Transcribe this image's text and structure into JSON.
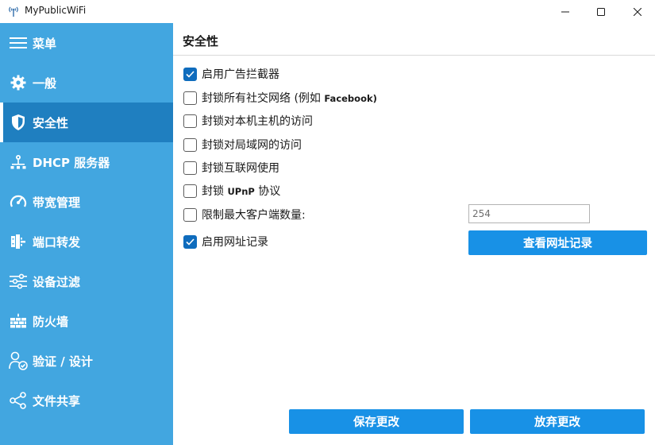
{
  "window": {
    "title": "MyPublicWiFi",
    "app_icon": "wifi-antenna-icon",
    "controls": {
      "minimize": "minimize-icon",
      "maximize": "maximize-icon",
      "close": "close-icon"
    }
  },
  "sidebar": {
    "background": "#42a6e0",
    "active_background": "#1f7fc0",
    "items": [
      {
        "label": "菜单",
        "icon": "hamburger-menu-icon",
        "active": false
      },
      {
        "label": "一般",
        "icon": "gear-icon",
        "active": false
      },
      {
        "label": "安全性",
        "icon": "shield-icon",
        "active": true
      },
      {
        "label": "DHCP 服务器",
        "icon": "network-icon",
        "active": false
      },
      {
        "label": "带宽管理",
        "icon": "speedometer-icon",
        "active": false
      },
      {
        "label": "端口转发",
        "icon": "port-forward-icon",
        "active": false
      },
      {
        "label": "设备过滤",
        "icon": "sliders-icon",
        "active": false
      },
      {
        "label": "防火墙",
        "icon": "firewall-icon",
        "active": false
      },
      {
        "label": "验证 / 设计",
        "icon": "user-check-icon",
        "active": false
      },
      {
        "label": "文件共享",
        "icon": "share-icon",
        "active": false
      }
    ]
  },
  "main": {
    "title": "安全性",
    "options": [
      {
        "label": "启用广告拦截器",
        "checked": true
      },
      {
        "label": "封锁所有社交网络 (例如 ",
        "label_suffix": "Facebook)",
        "checked": false
      },
      {
        "label": "封锁对本机主机的访问",
        "checked": false
      },
      {
        "label": "封锁对局域网的访问",
        "checked": false
      },
      {
        "label": "封锁互联网使用",
        "checked": false
      },
      {
        "label": "封锁 ",
        "label_mid": "UPnP",
        "label_suffix": " 协议",
        "checked": false
      },
      {
        "label": "限制最大客户端数量:",
        "checked": false
      },
      {
        "label": "启用网址记录",
        "checked": true
      }
    ],
    "max_clients_value": "254",
    "view_log_button": "查看网址记录",
    "save_button": "保存更改",
    "discard_button": "放弃更改",
    "accent": "#1891e6",
    "checkbox_color": "#0f6cbd"
  }
}
